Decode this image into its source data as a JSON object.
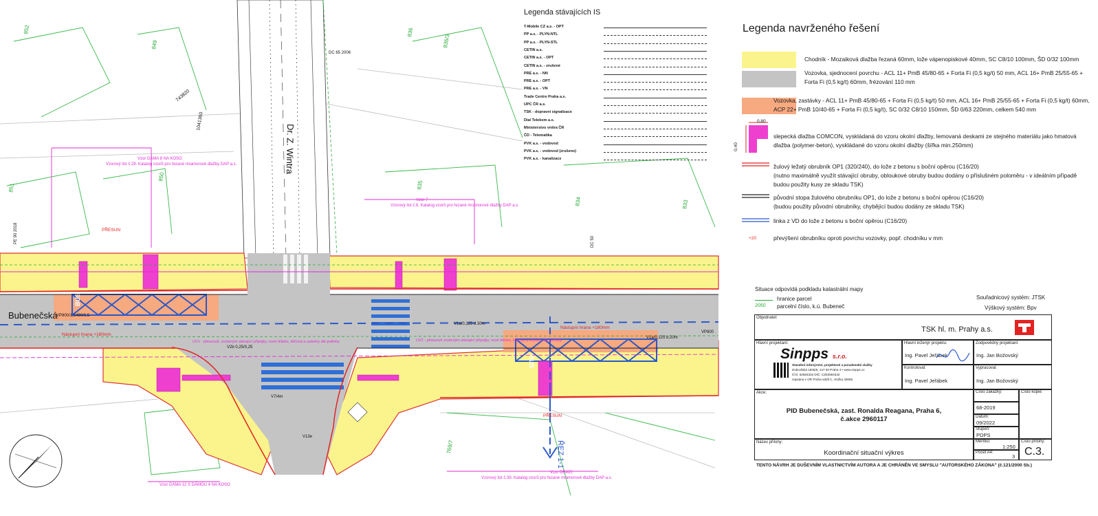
{
  "street": {
    "name": "Bubenečská",
    "side_street": "Dr. Z. Wintra",
    "rez": "ŘEZ 1-1"
  },
  "existing_legend": {
    "title": "Legenda stávajících IS",
    "rows": [
      "T-Mobile CZ a.s. - OPT",
      "PP a.s. - PLYN-NTL",
      "PP a.s. - PLYN-STL",
      "CETIN a.s.",
      "CETIN a.s. - OPT",
      "CETIN a.s. - zrušené",
      "PRE a.s. - NN",
      "PRE a.s. - OPT",
      "PRE a.s. - VN",
      "Trade Centre Praha a.s.",
      "UPC ČR a.s.",
      "TSK - dopravní signalizace",
      "Dial Telekom a.s.",
      "Ministerstvo vnitra ČR",
      "ČD - Telematika",
      "PVK a.s. - vodovod",
      "PVK a.s. - vodovod (zrušeno)",
      "PVK a.s. - kanalizace"
    ]
  },
  "proposed_legend": {
    "title": "Legenda navrženého řešení",
    "items": {
      "chodnik": "Chodník - Mozaiková dlažba řezaná 60mm, lože vápenopiskové 40mm, SC C8/10 100mm, ŠD 0/32 100mm",
      "vozovka": "Vozovka, sjednocení povrchu - ACL 11+ PmB 45/80-65 + Forta Fi (0,5 kg/t) 50 mm, ACL 16+ PmB 25/55-65 + Forta Fi (0,5 kg/t) 60mm, frézování 110 mm",
      "zastavky": "Vozovka, zastávky - ACL 11+ PmB 45/80-65 + Forta Fi (0,5 kg/t) 50 mm, ACL 16+ PmB 25/55-65 + Forta Fi (0,5 kg/t) 60mm, ACP 22+ PmB 10/40-65 + Forta Fi (0,5 kg/t), SC 0/32 C8/10 150mm, ŠD 0/63 220mm, celkem 540 mm",
      "comcon": "slepecká dlažba COMCON, vyskládaná do vzoru okolní dlažby, lemovaná deskami ze stejného materiálu jako hmatová dlažba (polymer-beton), vyskládané do vzoru okolní dlažby (šířka min.250mm)",
      "comcon_dim_a": "0,80",
      "comcon_dim_b": "0,40",
      "obrubnik_red": "žulový ležatý obrubník OP1 (320/240), do lože z betonu s boční opěrou (C16/20)",
      "obrubnik_red_note": "(nutno maximálně využít stávající obruby, obloukové obruby budou dodány o příslušném poloměru - v ideálním případě budou použity kusy ze skladu TSK)",
      "obrubnik_black": "původní stopa žulového obrubníku OP1, do lože z betonu s boční opěrou (C16/20)",
      "obrubnik_black_note": "(budou použity původní obrubníky, chybějící budou dodány ze skladu TSK)",
      "linka_vd": "linka z VD do lože z betonu s boční opěrou (C16/20)",
      "prevyseni_value": "+20",
      "prevyseni": "převýšení obrubníku oproti povrchu vozovky, popř. chodníku v mm"
    }
  },
  "notes": {
    "cadastre": "Situace odpovídá podkladu katastrální mapy",
    "hranice": "hranice parcel",
    "parcel_num": "2050",
    "parcel_text": "parcelní číslo, k.ú. Bubeneč",
    "coord": "Souřadnicový systém: JTSK",
    "height": "Výškový systém: Bpv"
  },
  "title_block": {
    "objednatel_label": "Objednatel:",
    "objednatel": "TSK hl. m. Prahy a.s.",
    "hlavni_projektant_label": "Hlavní projektant:",
    "hip_label": "Hlavní inženýr projektu:",
    "hip": "Ing. Pavel Jeřábek",
    "zodp_label": "Zodpovědný projektant:",
    "zodp": "Ing. Jan Božovský",
    "kontroloval_label": "Kontroloval:",
    "kontroloval": "Ing. Pavel Jeřábek",
    "vypracoval_label": "Vypracoval:",
    "vypracoval": "Ing. Jan Božovský",
    "company": "Sinpps s.r.o.",
    "company_desc": "Stavební inženýrství, projektové a poradenské služby",
    "company_addr": "Dobrušská 1805/5, 147 00 Praha 4 • www.sinpps.cz",
    "company_ico": "IČO: 62584332 DIČ: CZ62584332",
    "company_reg": "zapsána v OR Praha oddíl C, vložka 33665",
    "akce_label": "Akce:",
    "akce": "PID Bubenečská, zast. Ronalda Reagana, Praha 6,",
    "akce_num": "č.akce 2960117",
    "cislo_zakazky_label": "Číslo zakázky:",
    "cislo_zakazky": "68-2019",
    "cislo_kopie_label": "Číslo kopie:",
    "datum_label": "Datum:",
    "datum": "09/2022",
    "stupen_label": "Stupeň:",
    "stupen": "PDPS",
    "priloha_label": "Název přílohy:",
    "priloha": "Koordinační situační výkres",
    "meritko_label": "Měřítko:",
    "meritko": "1:250",
    "pocet_label": "Počet A4:",
    "pocet": "3",
    "cislo_prilohy_label": "Číslo přílohy:",
    "cislo_prilohy": "C.3.",
    "copyright": "TENTO NÁVRH JE DUŠEVNÍM VLASTNICTVÍM AUTORA A JE CHRÁNĚN VE SMYSLU \"AUTORSKÉHO ZÁKONA\" (č.121/2000 Sb.)"
  },
  "plan_labels": {
    "vzor1": "Vzor DÁMA 8 NA KOSO",
    "vzor1b": "Vzorový list č.29. Katalog vzorů pro řezané mramorové dlažby DAP a.s.",
    "vzor2": "Vzor 7",
    "vzor2b": "Vzorový list č.8. Katalog vzorů pro řezané mramorové dlažby DAP a.s.",
    "vzor3": "Vzor DRACI",
    "vzor3b": "Vzorový list č.39. Katalog vzorů pro řezané mramorové dlažby DAP a.s.",
    "vzor4": "Vzor DÁMA 12 S DÁMOU 4 NA KOSO",
    "presun": "PŘESUN",
    "parcels": [
      "852",
      "849",
      "836",
      "836/3",
      "743820",
      "1041360",
      "835",
      "834",
      "833",
      "851",
      "850",
      "769/7"
    ],
    "vp": "VP800/1,5490/0,5",
    "vp2": "VP800",
    "hrana": "Nástupní hrana +180mm",
    "hrana2": "Nástupní hrana +180mm",
    "v1a": "V1a/0,125 d.30m",
    "v1a2": "V1a/0,125 d.20m",
    "v2b": "V2b 0,25/0,25",
    "v4": "V7/4m",
    "v13": "V13e",
    "bus": "BUS",
    "dc": "DC 65 2006",
    "dc2": "DC 50",
    "pe": "PE 90 2018",
    "uv1": "UV1 - přesunutí, zrušeným stávající přípojky, nové tělisko, klíčová a uzávěry dle potřeby",
    "uv2": "UV2 - přesunutí zrušeným stávající přípojky, nové tělisko, klíčová a uzávěry dle potřeby"
  }
}
